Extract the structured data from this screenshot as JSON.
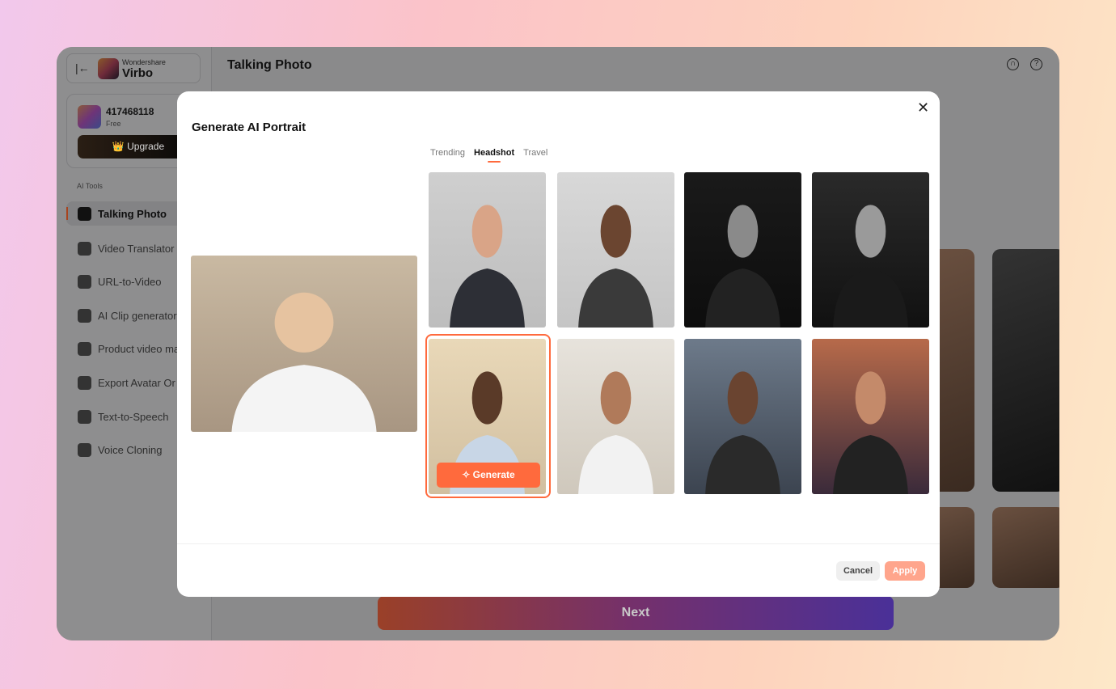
{
  "app": {
    "brand_small": "Wondershare",
    "brand": "Virbo",
    "page_title": "Talking Photo"
  },
  "account": {
    "id": "417468118",
    "plan": "Free",
    "upgrade": "Upgrade"
  },
  "sidebar": {
    "section": "AI Tools",
    "items": [
      {
        "label": "Talking Photo",
        "icon": "image-icon"
      },
      {
        "label": "Video Translator",
        "icon": "translate-icon"
      },
      {
        "label": "URL-to-Video",
        "icon": "url-icon"
      },
      {
        "label": "AI Clip generator",
        "icon": "clip-icon"
      },
      {
        "label": "Product video ma",
        "icon": "product-icon"
      },
      {
        "label": "Export Avatar Or",
        "icon": "avatar-icon"
      },
      {
        "label": "Text-to-Speech",
        "icon": "speech-icon"
      },
      {
        "label": "Voice Cloning",
        "icon": "voice-icon"
      }
    ]
  },
  "next_label": "Next",
  "modal": {
    "title": "Generate AI Portrait",
    "tabs": [
      "Trending",
      "Headshot",
      "Travel"
    ],
    "active_tab": "Headshot",
    "generate": "Generate",
    "cancel": "Cancel",
    "apply": "Apply"
  },
  "colors": {
    "accent": "#ff6a3d",
    "apply_disabled": "#ffa58c"
  }
}
